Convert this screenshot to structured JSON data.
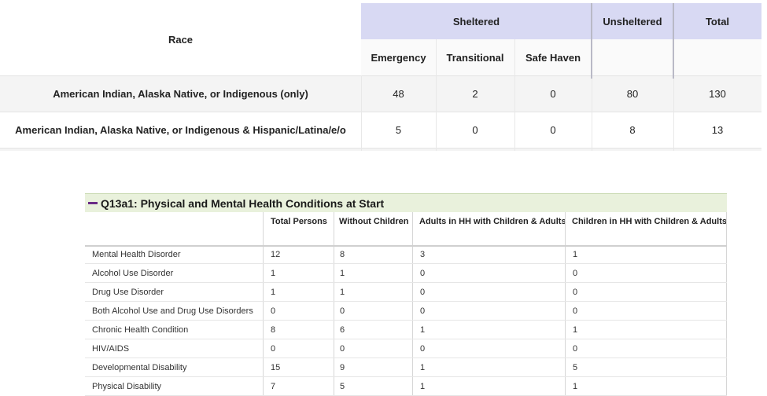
{
  "race_table": {
    "header": {
      "race": "Race",
      "sheltered": "Sheltered",
      "unsheltered": "Unsheltered",
      "total": "Total",
      "emergency": "Emergency",
      "transitional": "Transitional",
      "safe_haven": "Safe Haven"
    },
    "rows": [
      {
        "label": "American Indian, Alaska Native, or Indigenous (only)",
        "emergency": "48",
        "transitional": "2",
        "safe_haven": "0",
        "unsheltered": "80",
        "total": "130"
      },
      {
        "label": "American Indian, Alaska Native, or Indigenous & Hispanic/Latina/e/o",
        "emergency": "5",
        "transitional": "0",
        "safe_haven": "0",
        "unsheltered": "8",
        "total": "13"
      }
    ]
  },
  "q13a1": {
    "title": "Q13a1: Physical and Mental Health Conditions at Start",
    "columns": {
      "total_persons": "Total Persons",
      "without_children": "Without Children",
      "adults_hh": "Adults in HH with Children & Adults",
      "children_hh": "Children in HH with Children & Adults"
    },
    "rows": [
      {
        "label": "Mental Health Disorder",
        "total": "12",
        "without": "8",
        "adults": "3",
        "children": "1"
      },
      {
        "label": "Alcohol Use Disorder",
        "total": "1",
        "without": "1",
        "adults": "0",
        "children": "0"
      },
      {
        "label": "Drug Use Disorder",
        "total": "1",
        "without": "1",
        "adults": "0",
        "children": "0"
      },
      {
        "label": "Both Alcohol Use and Drug Use Disorders",
        "total": "0",
        "without": "0",
        "adults": "0",
        "children": "0"
      },
      {
        "label": "Chronic Health Condition",
        "total": "8",
        "without": "6",
        "adults": "1",
        "children": "1"
      },
      {
        "label": "HIV/AIDS",
        "total": "0",
        "without": "0",
        "adults": "0",
        "children": "0"
      },
      {
        "label": "Developmental Disability",
        "total": "15",
        "without": "9",
        "adults": "1",
        "children": "5"
      },
      {
        "label": "Physical Disability",
        "total": "7",
        "without": "5",
        "adults": "1",
        "children": "1"
      }
    ]
  }
}
